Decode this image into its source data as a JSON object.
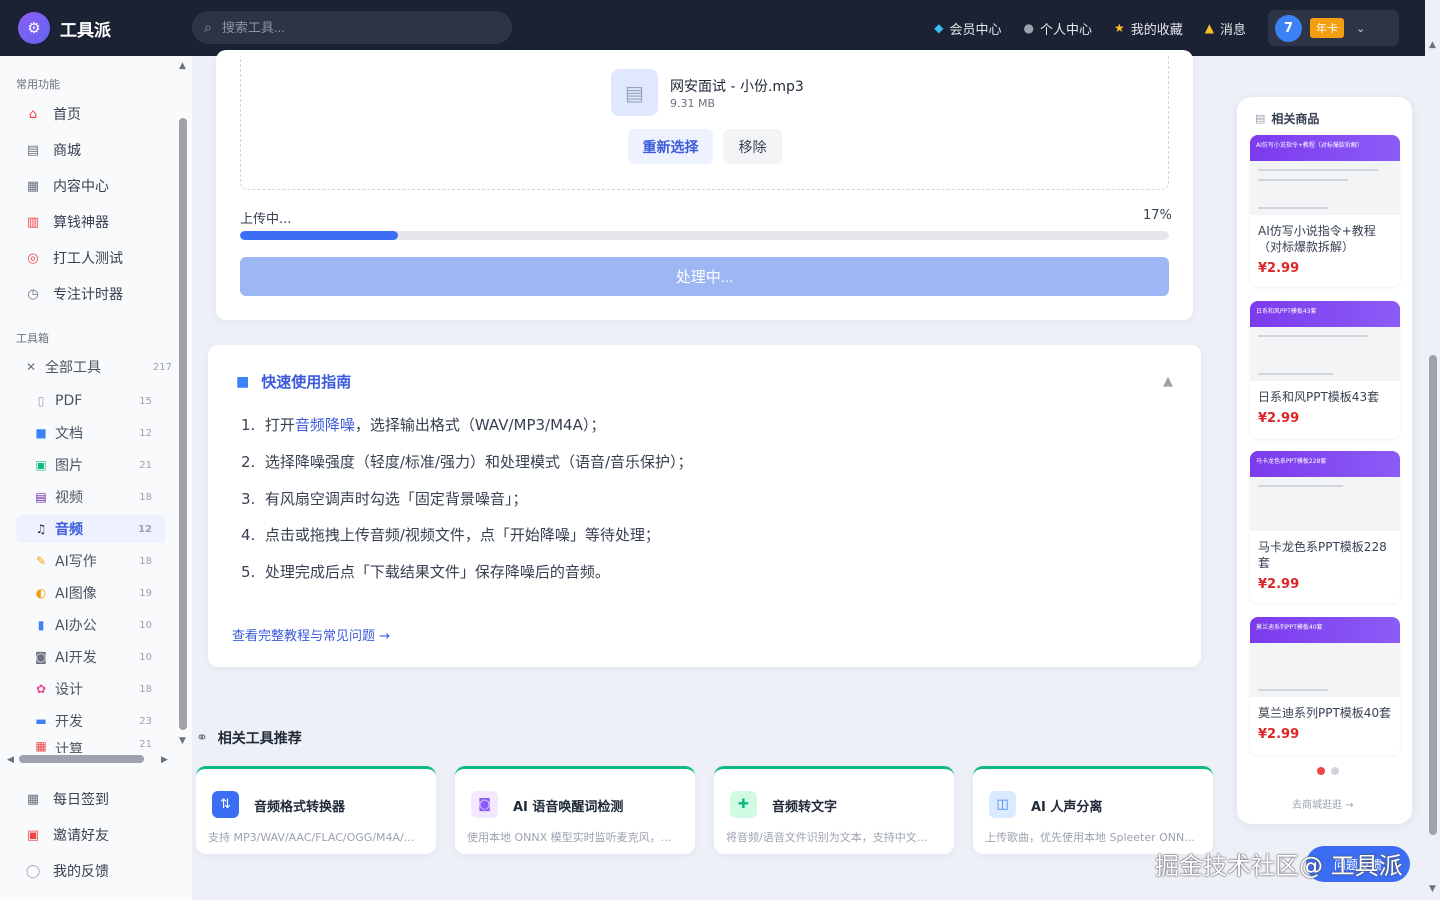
{
  "header": {
    "app_name": "工具派",
    "search_placeholder": "搜索工具...",
    "nav": [
      {
        "label": "会员中心",
        "icon": "diamond-icon"
      },
      {
        "label": "个人中心",
        "icon": "person-icon"
      },
      {
        "label": "我的收藏",
        "icon": "star-icon"
      },
      {
        "label": "消息",
        "icon": "bell-icon"
      }
    ],
    "user_avatar": "7",
    "user_badge": "年卡"
  },
  "sidebar": {
    "common_title": "常用功能",
    "common": [
      {
        "label": "首页",
        "icon": "home-icon"
      },
      {
        "label": "商城",
        "icon": "cart-icon"
      },
      {
        "label": "内容中心",
        "icon": "news-icon"
      },
      {
        "label": "算钱神器",
        "icon": "abacus-icon"
      },
      {
        "label": "打工人测试",
        "icon": "target-icon"
      },
      {
        "label": "专注计时器",
        "icon": "timer-icon"
      }
    ],
    "toolbox_title": "工具箱",
    "all_tools": {
      "label": "全部工具",
      "count": "217"
    },
    "categories": [
      {
        "label": "PDF",
        "count": "15"
      },
      {
        "label": "文档",
        "count": "12"
      },
      {
        "label": "图片",
        "count": "21"
      },
      {
        "label": "视频",
        "count": "18"
      },
      {
        "label": "音频",
        "count": "12"
      },
      {
        "label": "AI写作",
        "count": "18"
      },
      {
        "label": "AI图像",
        "count": "19"
      },
      {
        "label": "AI办公",
        "count": "10"
      },
      {
        "label": "AI开发",
        "count": "10"
      },
      {
        "label": "设计",
        "count": "18"
      },
      {
        "label": "开发",
        "count": "23"
      },
      {
        "label": "计算",
        "count": "21"
      }
    ],
    "bottom": [
      {
        "label": "每日签到",
        "icon": "calendar-icon"
      },
      {
        "label": "邀请好友",
        "icon": "gift-icon"
      },
      {
        "label": "我的反馈",
        "icon": "chat-icon"
      }
    ]
  },
  "upload": {
    "file_name": "网安面试 - 小份.mp3",
    "file_size": "9.31 MB",
    "reselect_label": "重新选择",
    "remove_label": "移除",
    "status_label": "上传中...",
    "progress_text": "17%",
    "progress": 0.17,
    "process_button": "处理中..."
  },
  "guide": {
    "title": "快速使用指南",
    "steps": [
      {
        "num": "1.",
        "pre": "打开",
        "hl": "音频降噪",
        "post": "，选择输出格式（WAV/MP3/M4A）；"
      },
      {
        "num": "2.",
        "text": "选择降噪强度（轻度/标准/强力）和处理模式（语音/音乐保护）；"
      },
      {
        "num": "3.",
        "text": "有风扇空调声时勾选「固定背景噪音」；"
      },
      {
        "num": "4.",
        "text": "点击或拖拽上传音频/视频文件，点「开始降噪」等待处理；"
      },
      {
        "num": "5.",
        "text": "处理完成后点「下载结果文件」保存降噪后的音频。"
      }
    ],
    "link": "查看完整教程与常见问题 →"
  },
  "related": {
    "title": "相关工具推荐",
    "tools": [
      {
        "name": "音频格式转换器",
        "desc": "支持 MP3/WAV/AAC/FLAC/OGG/M4A/...",
        "icon": "convert-icon",
        "color": "#3b6ef5",
        "bg": "#e0e7ff"
      },
      {
        "name": "AI 语音唤醒词检测",
        "desc": "使用本地 ONNX 模型实时监听麦克风，...",
        "icon": "robot-icon",
        "color": "#8b5cf6",
        "bg": "#f3e8ff"
      },
      {
        "name": "音频转文字",
        "desc": "将音频/语音文件识别为文本，支持中文...",
        "icon": "transcribe-icon",
        "color": "#10b981",
        "bg": "#d1fae5"
      },
      {
        "name": "AI 人声分离",
        "desc": "上传歌曲，优先使用本地 Spleeter ONN...",
        "icon": "separate-icon",
        "color": "#3b82f6",
        "bg": "#dbeafe"
      }
    ]
  },
  "products": {
    "title": "相关商品",
    "items": [
      {
        "band": "AI仿写小说指令+教程（对标爆款拆解）",
        "name": "AI仿写小说指令+教程（对标爆款拆解）",
        "price": "¥2.99"
      },
      {
        "band": "日系和风PPT模板43套",
        "name": "日系和风PPT模板43套",
        "price": "¥2.99"
      },
      {
        "band": "马卡龙色系PPT模板228套",
        "name": "马卡龙色系PPT模板228套",
        "price": "¥2.99"
      },
      {
        "band": "莫兰迪系列PPT模板40套",
        "name": "莫兰迪系列PPT模板40套",
        "price": "¥2.99"
      }
    ],
    "more_link": "去商城逛逛 →"
  },
  "watermark": "掘金技术社区@ 工具派",
  "float_button": "问题反馈",
  "colors": {
    "accent": "#3b6ef5",
    "price": "#dc2626",
    "topbar": "#1b2233"
  }
}
